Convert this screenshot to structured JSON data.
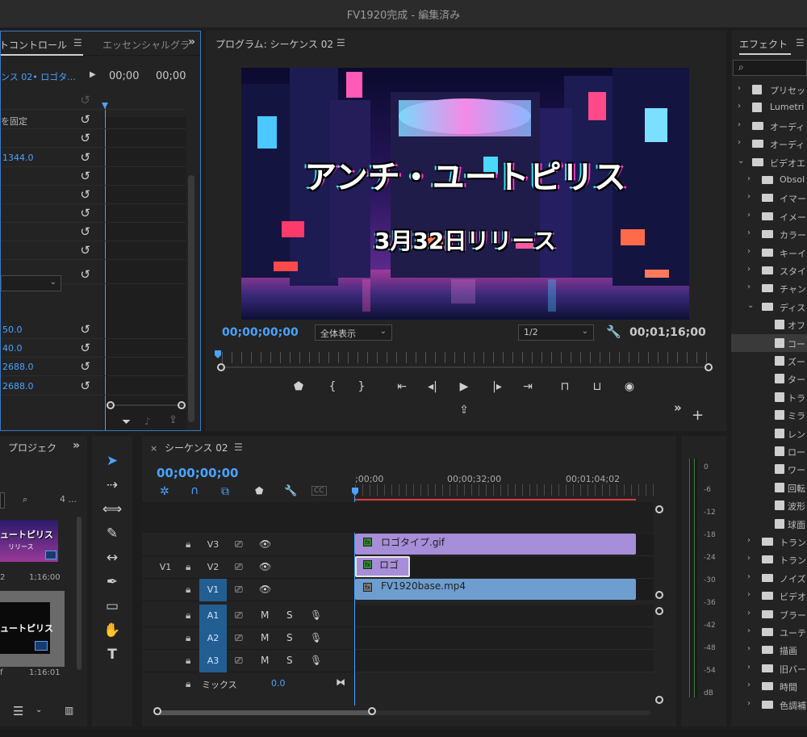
{
  "window": {
    "title": "FV1920完成 - 編集済み"
  },
  "effect_controls": {
    "tab_label": "トコントロール",
    "tab2_label": "エッセンシャルグラ",
    "clip_selector": "ンス 02• ロゴタ...",
    "tc_left": "00;00",
    "tc_right": "00;00",
    "rows": [
      {
        "text": "",
        "value": ""
      },
      {
        "text": "を固定",
        "value": ""
      },
      {
        "text": "",
        "value": ""
      },
      {
        "text": "",
        "value": "1344.0"
      },
      {
        "text": "",
        "value": ""
      },
      {
        "text": "",
        "value": ""
      },
      {
        "text": "",
        "value": ""
      },
      {
        "text": "",
        "value": ""
      },
      {
        "text": "",
        "value": ""
      },
      {
        "text": "",
        "value": ""
      },
      {
        "text": "",
        "value": "50.0"
      },
      {
        "text": "",
        "value": "40.0"
      },
      {
        "text": "",
        "value": "2688.0"
      },
      {
        "text": "",
        "value": "2688.0"
      }
    ]
  },
  "program_monitor": {
    "title": "プログラム: シーケンス 02",
    "video_title": "アンチ・ユートピリス",
    "video_subtitle": "3月32日リリース",
    "timecode_current": "00;00;00;00",
    "timecode_duration": "00;01;16;00",
    "zoom_select": "全体表示",
    "resolution_select": "1/2"
  },
  "project": {
    "tab_label": "プロジェク",
    "item_count": "4 ...",
    "thumb1_title": "ュートピリス",
    "thumb1_sub": "リリース",
    "thumb1_left": "2",
    "thumb1_duration": "1;16;00",
    "thumb2_title": "ュートピリス",
    "thumb2_left": "f",
    "thumb2_duration": "1:16:01"
  },
  "timeline": {
    "tab_label": "シーケンス 02",
    "timecode": "00;00;00;00",
    "ruler": [
      ";00;00",
      "00;00;32;00",
      "00;01;04;02"
    ],
    "tracks": [
      {
        "label": "V3",
        "src": "",
        "active": false,
        "clip": "ロゴタイプ.gif"
      },
      {
        "label": "V2",
        "src": "V1",
        "active": false,
        "clip": "ロゴ"
      },
      {
        "label": "V1",
        "src": "",
        "active": true,
        "clip": "FV1920base.mp4"
      },
      {
        "label": "A1",
        "src": "",
        "active": true
      },
      {
        "label": "A2",
        "src": "",
        "active": true
      },
      {
        "label": "A3",
        "src": "",
        "active": true
      }
    ],
    "mix_label": "ミックス",
    "mix_value": "0.0",
    "m_label": "M",
    "s_label": "S"
  },
  "meter": {
    "scale": [
      "0",
      "-6",
      "-12",
      "-18",
      "-24",
      "-30",
      "-36",
      "-42",
      "-48",
      "-54",
      "dB"
    ]
  },
  "effects": {
    "tab_label": "エフェクト",
    "items": [
      {
        "label": "プリセット",
        "type": "preset",
        "indent": 0,
        "arrow": "›"
      },
      {
        "label": "Lumetri",
        "type": "preset",
        "indent": 0,
        "arrow": "›"
      },
      {
        "label": "オーディ",
        "type": "folder",
        "indent": 0,
        "arrow": "›"
      },
      {
        "label": "オーディ",
        "type": "folder",
        "indent": 0,
        "arrow": "›"
      },
      {
        "label": "ビデオエ",
        "type": "folder",
        "indent": 0,
        "arrow": "⌄"
      },
      {
        "label": "Obsol",
        "type": "folder",
        "indent": 1,
        "arrow": "›"
      },
      {
        "label": "イマー",
        "type": "folder",
        "indent": 1,
        "arrow": "›"
      },
      {
        "label": "イメー",
        "type": "folder",
        "indent": 1,
        "arrow": "›"
      },
      {
        "label": "カラー",
        "type": "folder",
        "indent": 1,
        "arrow": "›"
      },
      {
        "label": "キーイ",
        "type": "folder",
        "indent": 1,
        "arrow": "›"
      },
      {
        "label": "スタイ",
        "type": "folder",
        "indent": 1,
        "arrow": "›"
      },
      {
        "label": "チャン",
        "type": "folder",
        "indent": 1,
        "arrow": "›"
      },
      {
        "label": "ディス",
        "type": "folder",
        "indent": 1,
        "arrow": "⌄"
      },
      {
        "label": "オフ",
        "type": "effect",
        "indent": 2,
        "arrow": ""
      },
      {
        "label": "コー",
        "type": "effect",
        "indent": 2,
        "arrow": "",
        "selected": true
      },
      {
        "label": "ズー",
        "type": "effect",
        "indent": 2,
        "arrow": ""
      },
      {
        "label": "ター",
        "type": "effect",
        "indent": 2,
        "arrow": ""
      },
      {
        "label": "トラ",
        "type": "effect",
        "indent": 2,
        "arrow": ""
      },
      {
        "label": "ミラ",
        "type": "effect",
        "indent": 2,
        "arrow": ""
      },
      {
        "label": "レン",
        "type": "effect",
        "indent": 2,
        "arrow": ""
      },
      {
        "label": "ロー",
        "type": "effect",
        "indent": 2,
        "arrow": ""
      },
      {
        "label": "ワー",
        "type": "effect",
        "indent": 2,
        "arrow": ""
      },
      {
        "label": "回転",
        "type": "effect",
        "indent": 2,
        "arrow": ""
      },
      {
        "label": "波形",
        "type": "effect",
        "indent": 2,
        "arrow": ""
      },
      {
        "label": "球面",
        "type": "effect",
        "indent": 2,
        "arrow": ""
      },
      {
        "label": "トラン",
        "type": "folder",
        "indent": 1,
        "arrow": "›"
      },
      {
        "label": "トラン",
        "type": "folder",
        "indent": 1,
        "arrow": "›"
      },
      {
        "label": "ノイズ",
        "type": "folder",
        "indent": 1,
        "arrow": "›"
      },
      {
        "label": "ビデオ",
        "type": "folder",
        "indent": 1,
        "arrow": "›"
      },
      {
        "label": "ブラー",
        "type": "folder",
        "indent": 1,
        "arrow": "›"
      },
      {
        "label": "ユーテ",
        "type": "folder",
        "indent": 1,
        "arrow": "›"
      },
      {
        "label": "描画",
        "type": "folder",
        "indent": 1,
        "arrow": "›"
      },
      {
        "label": "旧バー",
        "type": "folder",
        "indent": 1,
        "arrow": "›"
      },
      {
        "label": "時間",
        "type": "folder",
        "indent": 1,
        "arrow": "›"
      },
      {
        "label": "色調補",
        "type": "folder",
        "indent": 1,
        "arrow": "›"
      }
    ]
  }
}
